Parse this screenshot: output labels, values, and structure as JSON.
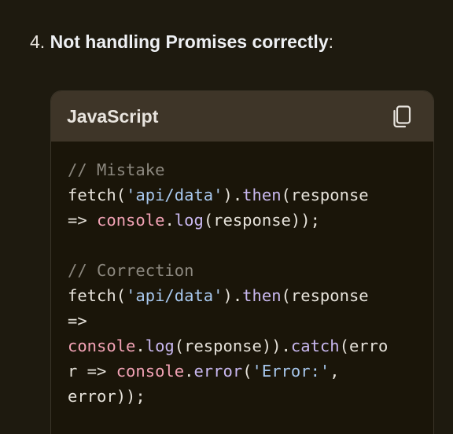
{
  "heading": {
    "number": "4.",
    "title": "Not handling Promises correctly",
    "suffix": ":"
  },
  "code_block": {
    "language": "JavaScript",
    "copy_icon": "copy-icon",
    "lines": [
      [
        {
          "t": "// Mistake",
          "c": "comment"
        }
      ],
      [
        {
          "t": "fetch(",
          "c": "plain"
        },
        {
          "t": "'api/data'",
          "c": "string"
        },
        {
          "t": ").",
          "c": "plain"
        },
        {
          "t": "then",
          "c": "method"
        },
        {
          "t": "(response",
          "c": "plain"
        }
      ],
      [
        {
          "t": "=> ",
          "c": "plain"
        },
        {
          "t": "console",
          "c": "obj"
        },
        {
          "t": ".",
          "c": "plain"
        },
        {
          "t": "log",
          "c": "method"
        },
        {
          "t": "(response));",
          "c": "plain"
        }
      ],
      [
        {
          "t": "",
          "c": "plain"
        }
      ],
      [
        {
          "t": "// Correction",
          "c": "comment"
        }
      ],
      [
        {
          "t": "fetch(",
          "c": "plain"
        },
        {
          "t": "'api/data'",
          "c": "string"
        },
        {
          "t": ").",
          "c": "plain"
        },
        {
          "t": "then",
          "c": "method"
        },
        {
          "t": "(response",
          "c": "plain"
        }
      ],
      [
        {
          "t": "=>",
          "c": "plain"
        }
      ],
      [
        {
          "t": "console",
          "c": "obj"
        },
        {
          "t": ".",
          "c": "plain"
        },
        {
          "t": "log",
          "c": "method"
        },
        {
          "t": "(response)).",
          "c": "plain"
        },
        {
          "t": "catch",
          "c": "method"
        },
        {
          "t": "(erro",
          "c": "plain"
        }
      ],
      [
        {
          "t": "r => ",
          "c": "plain"
        },
        {
          "t": "console",
          "c": "obj"
        },
        {
          "t": ".",
          "c": "plain"
        },
        {
          "t": "error",
          "c": "method"
        },
        {
          "t": "(",
          "c": "plain"
        },
        {
          "t": "'Error:'",
          "c": "string"
        },
        {
          "t": ",",
          "c": "plain"
        }
      ],
      [
        {
          "t": "error));",
          "c": "plain"
        }
      ]
    ]
  },
  "colors": {
    "background": "#1e1a0f",
    "header_bg": "#3e3528",
    "comment": "#8c887f",
    "string": "#a8c8ee",
    "method": "#c9b8f0",
    "object": "#f3a3b6"
  }
}
